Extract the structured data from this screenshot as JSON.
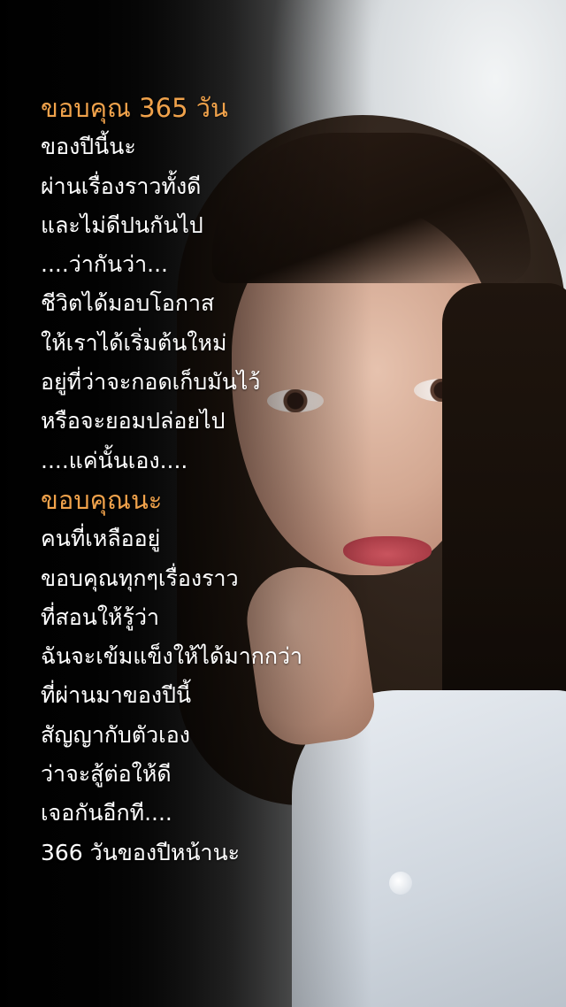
{
  "poem": {
    "lines": [
      {
        "text": "ขอบคุณ 365 วัน",
        "accent": true
      },
      {
        "text": "ของปีนี้นะ",
        "accent": false
      },
      {
        "text": "ผ่านเรื่องราวทั้งดี",
        "accent": false
      },
      {
        "text": "และไม่ดีปนกันไป",
        "accent": false
      },
      {
        "text": "....ว่ากันว่า...",
        "accent": false
      },
      {
        "text": "ชีวิตได้มอบโอกาส",
        "accent": false
      },
      {
        "text": "ให้เราได้เริ่มต้นใหม่",
        "accent": false
      },
      {
        "text": "อยู่ที่ว่าจะกอดเก็บมันไว้",
        "accent": false
      },
      {
        "text": "หรือจะยอมปล่อยไป",
        "accent": false
      },
      {
        "text": "....แค่นั้นเอง....",
        "accent": false
      },
      {
        "text": "ขอบคุณนะ",
        "accent": true
      },
      {
        "text": "คนที่เหลืออยู่",
        "accent": false
      },
      {
        "text": "ขอบคุณทุกๆเรื่องราว",
        "accent": false
      },
      {
        "text": "ที่สอนให้รู้ว่า",
        "accent": false
      },
      {
        "text": "ฉันจะเข้มแข็งให้ได้มากกว่า",
        "accent": false
      },
      {
        "text": "ที่ผ่านมาของปีนี้",
        "accent": false
      },
      {
        "text": "สัญญากับตัวเอง",
        "accent": false
      },
      {
        "text": "ว่าจะสู้ต่อให้ดี",
        "accent": false
      },
      {
        "text": "เจอกันอีกที....",
        "accent": false
      },
      {
        "text": "366 วันของปีหน้านะ",
        "accent": false
      }
    ]
  },
  "colors": {
    "accent": "#f0a24b",
    "text": "#ffffff"
  }
}
